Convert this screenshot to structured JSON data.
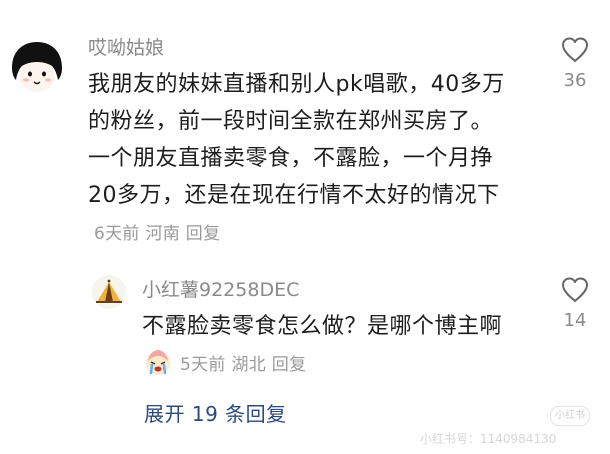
{
  "main_comment": {
    "username": "哎呦姑娘",
    "text": "我朋友的妹妹直播和别人pk唱歌，40多万的粉丝，前一段时间全款在郑州买房了。一个朋友直播卖零食，不露脸，一个月挣20多万，还是在现在行情不太好的情况下",
    "time": "6天前",
    "location": "河南",
    "reply_label": "回复",
    "likes": "36",
    "like_icon": "heart-outline-icon",
    "avatar_icon": "cartoon-girl-avatar"
  },
  "reply_comment": {
    "username": "小红薯92258DEC",
    "text_before_emoji": "不露脸卖零食怎么做？是哪个博主啊",
    "emoji": "crying-face-emoji",
    "time": "5天前",
    "location": "湖北",
    "reply_label": "回复",
    "likes": "14",
    "like_icon": "heart-outline-icon",
    "avatar_icon": "camping-tent-avatar"
  },
  "expand_replies": "展开 19 条回复",
  "watermark": {
    "badge": "小红书",
    "text": "小红书号：1140984130"
  },
  "colors": {
    "username": "#8a8a8a",
    "body": "#1d1d1d",
    "meta": "#9a9a9a",
    "link": "#2c4a7a"
  }
}
